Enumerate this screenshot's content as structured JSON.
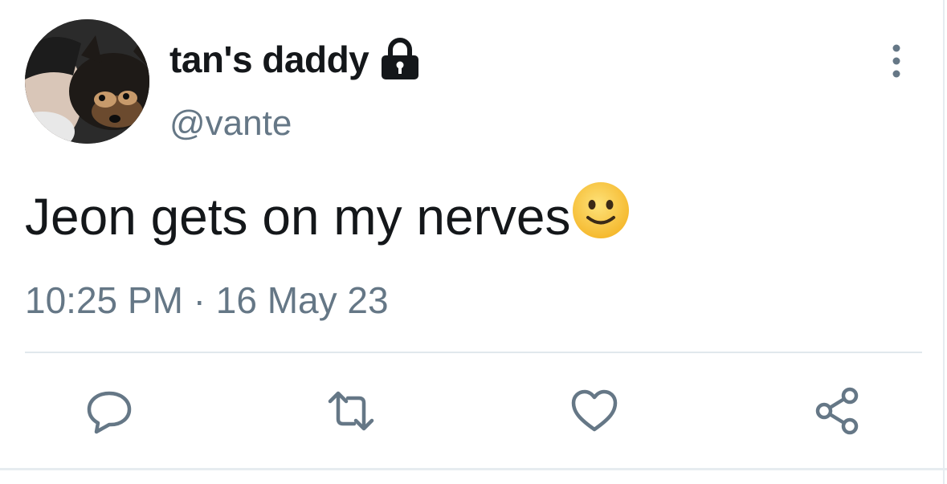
{
  "user": {
    "display_name": "tan's daddy",
    "handle": "@vante",
    "protected": true
  },
  "tweet": {
    "text": "Jeon gets on my nerves",
    "emoji": "slightly-smiling-face",
    "timestamp": "10:25 PM · 16 May 23"
  },
  "icons": {
    "lock": "lock-icon",
    "more": "more-vertical-icon",
    "reply": "reply-icon",
    "retweet": "retweet-icon",
    "like": "heart-icon",
    "share": "share-icon"
  },
  "colors": {
    "primary_text": "#14171a",
    "secondary_text": "#657786",
    "icon_gray": "#657786",
    "divider": "#e1e8ed",
    "emoji_yellow": "#f9cb3c"
  }
}
